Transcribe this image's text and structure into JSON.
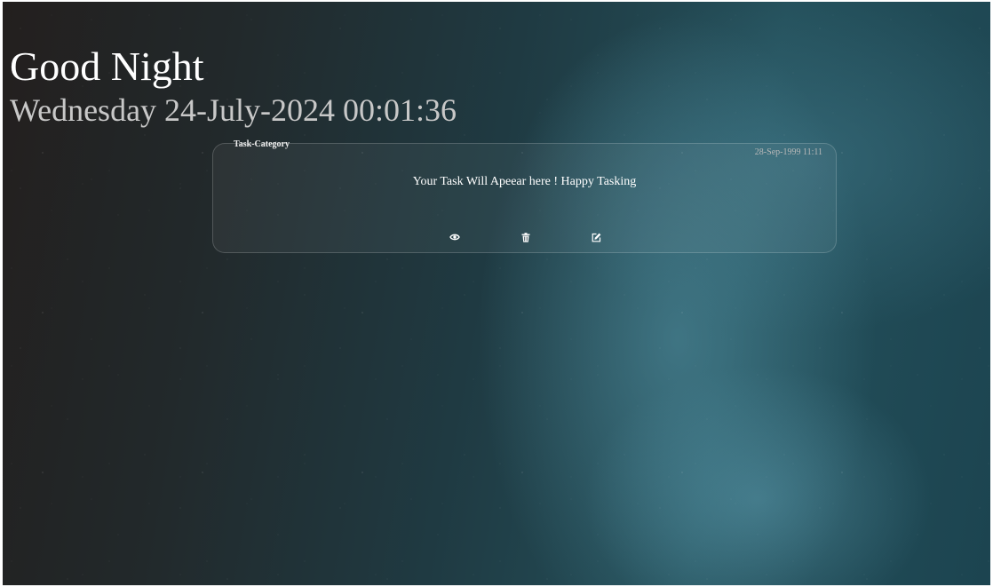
{
  "header": {
    "greeting": "Good Night",
    "datetime": "Wednesday 24-July-2024 00:01:36"
  },
  "task_card": {
    "category": "Task-Category",
    "date": "28-Sep-1999 11:11",
    "text": "Your Task Will Apeear here ! Happy Tasking",
    "actions": [
      {
        "icon": "eye-icon",
        "label": "view"
      },
      {
        "icon": "trash-icon",
        "label": "delete"
      },
      {
        "icon": "edit-icon",
        "label": "edit"
      }
    ]
  },
  "colors": {
    "greeting_text": "#ffffff",
    "datetime_text": "#c8c8c8",
    "card_border": "rgba(255,255,255,0.18)"
  }
}
